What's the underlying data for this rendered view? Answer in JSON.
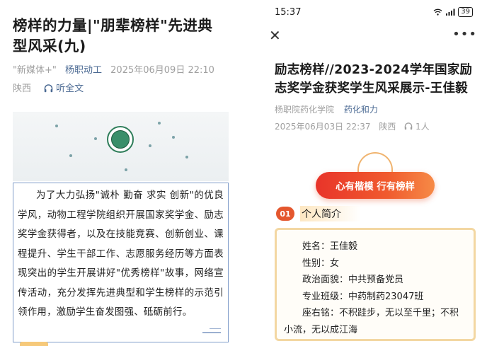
{
  "left_article": {
    "title": "榜样的力量|\"朋辈榜样\"先进典型风采(九)",
    "source": "\"新媒体+\"",
    "account": "杨职动工",
    "date": "2025年06月09日 22:10",
    "region": "陕西",
    "listen_label": "听全文",
    "body": "为了大力弘扬\"诚朴 勤奋 求实 创新\"的优良学风，动物工程学院组织开展国家奖学金、励志奖学金获得者，以及在技能竞赛、创新创业、课程提升、学生干部工作、志愿服务经历等方面表现突出的学生开展讲好\"优秀榜样\"故事，网络宣传活动，充分发挥先进典型和学生榜样的示范引领作用，激励学生奋发图强、砥砺前行。"
  },
  "status_bar": {
    "time": "15:37",
    "battery": "39"
  },
  "right_article": {
    "title": "励志榜样//2023-2024学年国家励志奖学金获奖学生风采展示-王佳毅",
    "source": "杨职院药化学院",
    "account": "药化和力",
    "date": "2025年06月03日 22:37",
    "region": "陕西",
    "listeners": "1人",
    "slogan": "心有楷模 行有榜样",
    "section_num": "01",
    "section_label": "个人简介",
    "profile": {
      "name": "姓名：王佳毅",
      "gender": "性别：女",
      "political": "政治面貌：中共预备党员",
      "class": "专业班级：中药制药23047班",
      "motto": "座右铭：不积跬步，无以至千里；不积小流，无以成江海"
    }
  },
  "icons": {
    "close": "close-icon",
    "more": "more-icon",
    "headphone": "headphone-icon",
    "wifi": "wifi-icon",
    "signal": "signal-icon",
    "battery": "battery-icon"
  },
  "colors": {
    "accent_blue": "#4b6a93",
    "slogan_red": "#e8342a",
    "section_orange": "#e4572e",
    "card_border": "#f3d7a2"
  }
}
